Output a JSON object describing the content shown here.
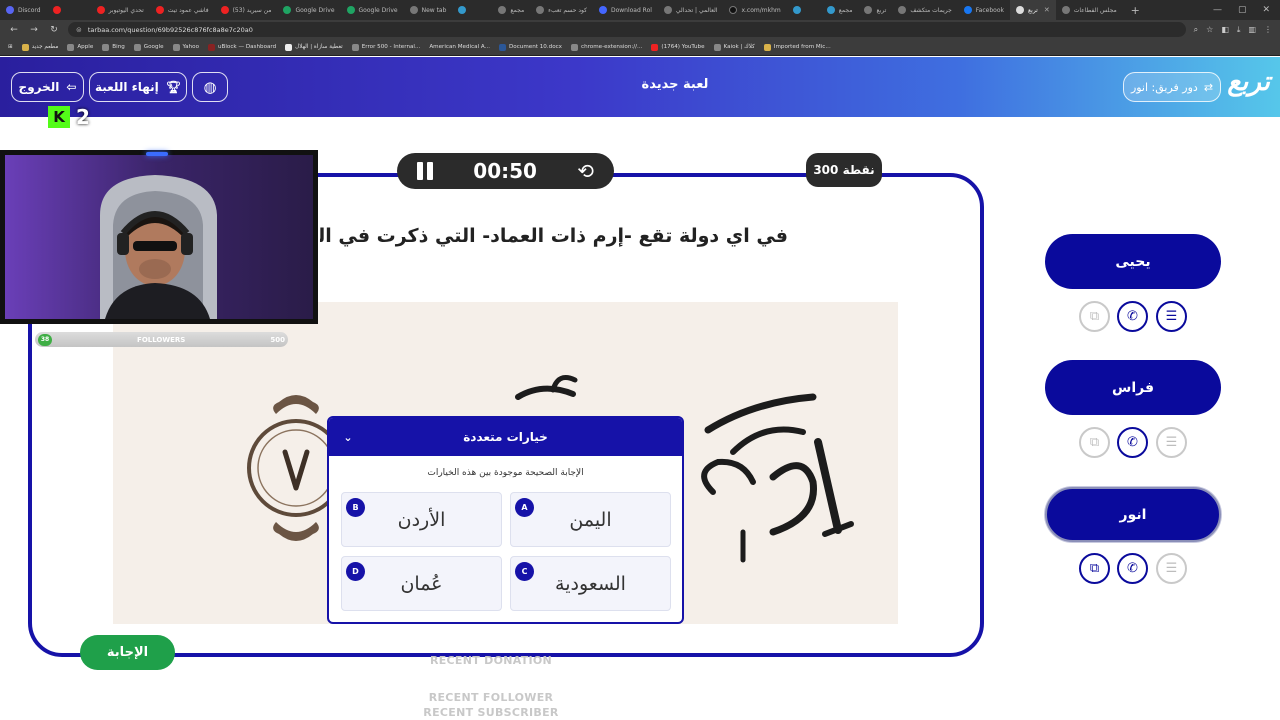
{
  "browser": {
    "tabs": [
      {
        "label": "Discord",
        "active": false
      },
      {
        "label": "",
        "active": false
      },
      {
        "label": "تحدي اليوتيوبر",
        "active": false
      },
      {
        "label": "فاشي عمود تيت",
        "active": false
      },
      {
        "label": "(53) من سيريد",
        "active": false
      },
      {
        "label": "Google Drive",
        "active": false
      },
      {
        "label": "Google Drive",
        "active": false
      },
      {
        "label": "New tab",
        "active": false
      },
      {
        "label": "",
        "active": false
      },
      {
        "label": "مجمع",
        "active": false
      },
      {
        "label": "كود حسم تعبء",
        "active": false
      },
      {
        "label": "Download Rol",
        "active": false
      },
      {
        "label": "العالمي | تحدالي",
        "active": false
      },
      {
        "label": "x.com/mkhm",
        "active": false
      },
      {
        "label": "",
        "active": false
      },
      {
        "label": "مجمع",
        "active": false
      },
      {
        "label": "تربع",
        "active": false
      },
      {
        "label": "جريمات متكشف",
        "active": false
      },
      {
        "label": "Facebook",
        "active": false
      },
      {
        "label": "تربع",
        "active": true
      },
      {
        "label": "مجلس الفطاعات",
        "active": false
      }
    ],
    "url": "tarbaa.com/question/69b92526c876fc8a8e7c20a0",
    "bookmarks": [
      "مطعم جديد",
      "Apple",
      "Bing",
      "Google",
      "Yahoo",
      "uBlock — Dashboard",
      "تغطية سازاة | الهلال",
      "Error 500 - Internal...",
      "American Medical A...",
      "Document 10.docx",
      "chrome-extension://...",
      "(1764) YouTube",
      "Kaiok | كلاك",
      "Imported from Mic..."
    ]
  },
  "header": {
    "exit_label": "الخروج",
    "end_game_label": "إنهاء اللعبة",
    "title": "لعبة جديدة",
    "turn_label": "دور فريق: انور",
    "logo": "تربع"
  },
  "question": {
    "timer": "00:50",
    "points": "300 نقطة",
    "text": "في اي دولة تقع -إرم ذات العماد- التي ذكرت في القر",
    "answer_button": "الإجابة"
  },
  "mcq_popup": {
    "title": "خيارات متعددة",
    "subtitle": "الإجابة الصحيحة موجودة بين هذه الخيارات",
    "options": [
      {
        "letter": "A",
        "text": "اليمن"
      },
      {
        "letter": "B",
        "text": "الأردن"
      },
      {
        "letter": "C",
        "text": "السعودية"
      },
      {
        "letter": "D",
        "text": "عُمان"
      }
    ]
  },
  "players": [
    {
      "name": "يحيى",
      "active": false,
      "lifelines": {
        "double": "used",
        "call": "available",
        "choices": "available"
      }
    },
    {
      "name": "فراس",
      "active": false,
      "lifelines": {
        "double": "used",
        "call": "available",
        "choices": "used"
      }
    },
    {
      "name": "انور",
      "active": true,
      "lifelines": {
        "double": "available",
        "call": "available",
        "choices": "used"
      }
    }
  ],
  "stream_overlay": {
    "kick_count": "2",
    "followers_label": "FOLLOWERS",
    "followers_current": "38",
    "followers_goal": "500",
    "recent_donation": "RECENT DONATION",
    "recent_follower": "RECENT FOLLOWER",
    "recent_subscriber": "RECENT SUBSCRIBER"
  },
  "colors": {
    "brand_navy": "#1612a8",
    "player_navy": "#0a0a9c",
    "answer_green": "#1fa04a",
    "kick_green": "#53fc18"
  }
}
